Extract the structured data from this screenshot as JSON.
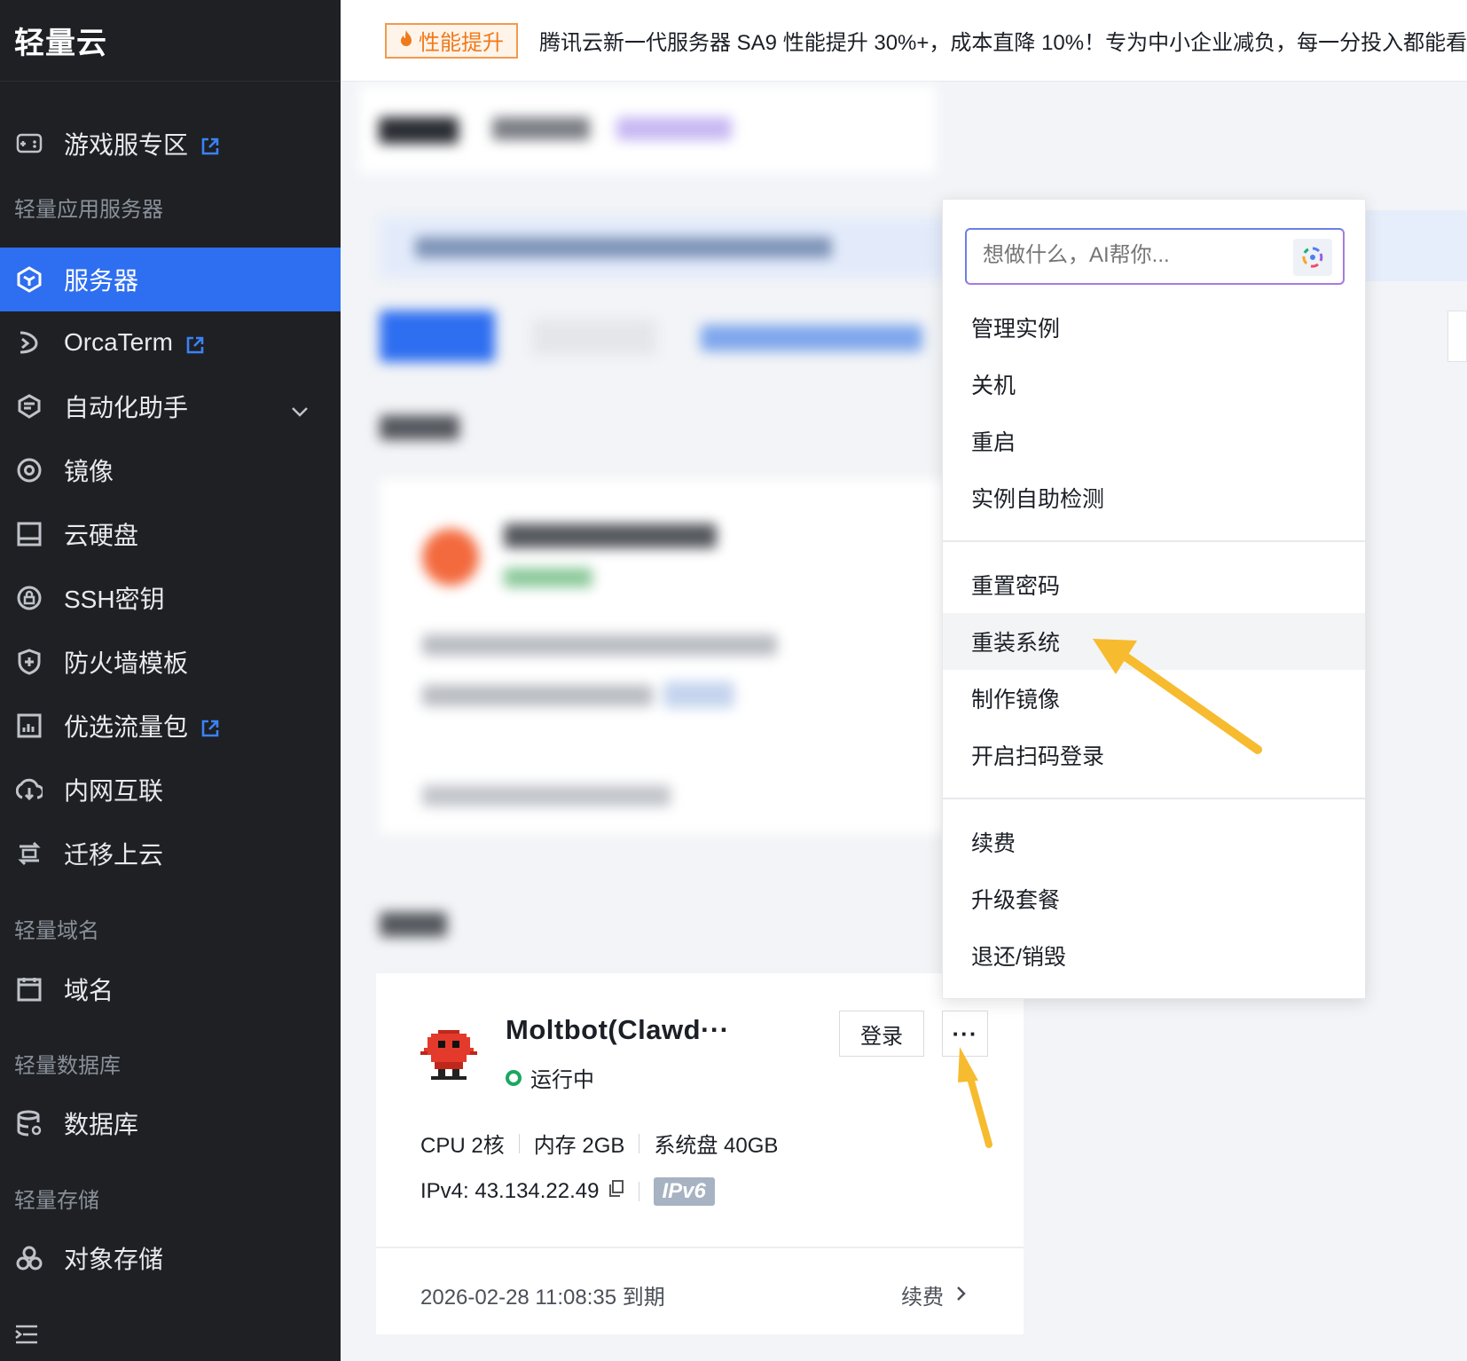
{
  "sidebar": {
    "brand": "轻量云",
    "items": [
      {
        "label": "游戏服专区",
        "icon": "gamepad-icon",
        "external": true
      },
      {
        "label": "服务器",
        "icon": "cube-icon",
        "active": true
      },
      {
        "label": "OrcaTerm",
        "icon": "terminal-icon",
        "external": true
      },
      {
        "label": "自动化助手",
        "icon": "automation-icon",
        "expandable": true
      },
      {
        "label": "镜像",
        "icon": "image-disc-icon"
      },
      {
        "label": "云硬盘",
        "icon": "disk-icon"
      },
      {
        "label": "SSH密钥",
        "icon": "key-icon"
      },
      {
        "label": "防火墙模板",
        "icon": "shield-icon"
      },
      {
        "label": "优选流量包",
        "icon": "traffic-chart-icon",
        "external": true
      },
      {
        "label": "内网互联",
        "icon": "network-icon"
      },
      {
        "label": "迁移上云",
        "icon": "migrate-icon"
      },
      {
        "label": "域名",
        "icon": "domain-icon"
      },
      {
        "label": "数据库",
        "icon": "database-icon"
      },
      {
        "label": "对象存储",
        "icon": "object-storage-icon"
      }
    ],
    "sections": [
      "轻量应用服务器",
      "轻量域名",
      "轻量数据库",
      "轻量存储"
    ]
  },
  "banner": {
    "badge": "性能提升",
    "text": "腾讯云新一代服务器 SA9 性能提升 30%+，成本直降 10%！专为中小企业减负，每一分投入都能看"
  },
  "menu": {
    "search_placeholder": "想做什么，AI帮你...",
    "group1": [
      "管理实例",
      "关机",
      "重启",
      "实例自助检测"
    ],
    "group2": [
      "重置密码",
      "重装系统",
      "制作镜像",
      "开启扫码登录"
    ],
    "group3": [
      "续费",
      "升级套餐",
      "退还/销毁"
    ],
    "highlighted": "重装系统"
  },
  "card": {
    "name": "Moltbot(Clawd···",
    "status": "运行中",
    "login_label": "登录",
    "more_label": "···",
    "cpu": "CPU 2核",
    "memory": "内存 2GB",
    "disk": "系统盘 40GB",
    "ipv4": "IPv4: 43.134.22.49",
    "ipv6_badge": "IPv6",
    "expire": "2026-02-28 11:08:35 到期",
    "renew": "续费"
  },
  "colors": {
    "sidebar_bg": "#1e2024",
    "active": "#2e6ef0",
    "status_green": "#1ba760",
    "arrow": "#f7bb2f",
    "badge_orange": "#ef7a1a"
  }
}
